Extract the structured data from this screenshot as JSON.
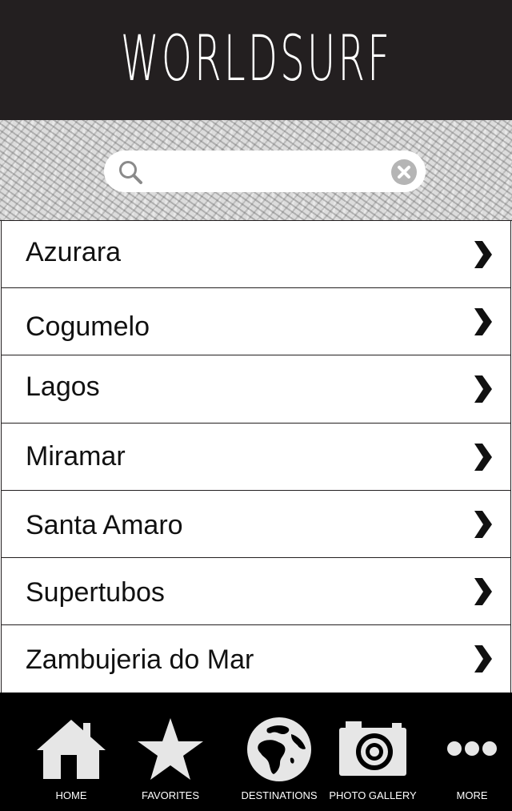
{
  "header": {
    "title": "WORLDSURF"
  },
  "search": {
    "value": "",
    "placeholder": ""
  },
  "destinations": [
    {
      "name": "Azurara"
    },
    {
      "name": "Cogumelo"
    },
    {
      "name": "Lagos"
    },
    {
      "name": "Miramar"
    },
    {
      "name": "Santa Amaro"
    },
    {
      "name": "Supertubos"
    },
    {
      "name": "Zambujeria do Mar"
    }
  ],
  "tabbar": {
    "tabs": [
      {
        "label": "HOME",
        "icon": "home-icon"
      },
      {
        "label": "FAVORITES",
        "icon": "star-icon"
      },
      {
        "label": "DESTINATIONS",
        "icon": "globe-icon"
      },
      {
        "label": "PHOTO GALLERY",
        "icon": "camera-icon"
      },
      {
        "label": "MORE",
        "icon": "more-icon"
      }
    ]
  },
  "colors": {
    "header_bg": "#231f20",
    "tabbar_bg": "#000000",
    "icon_fill": "#e6e6e6",
    "text": "#111111"
  }
}
